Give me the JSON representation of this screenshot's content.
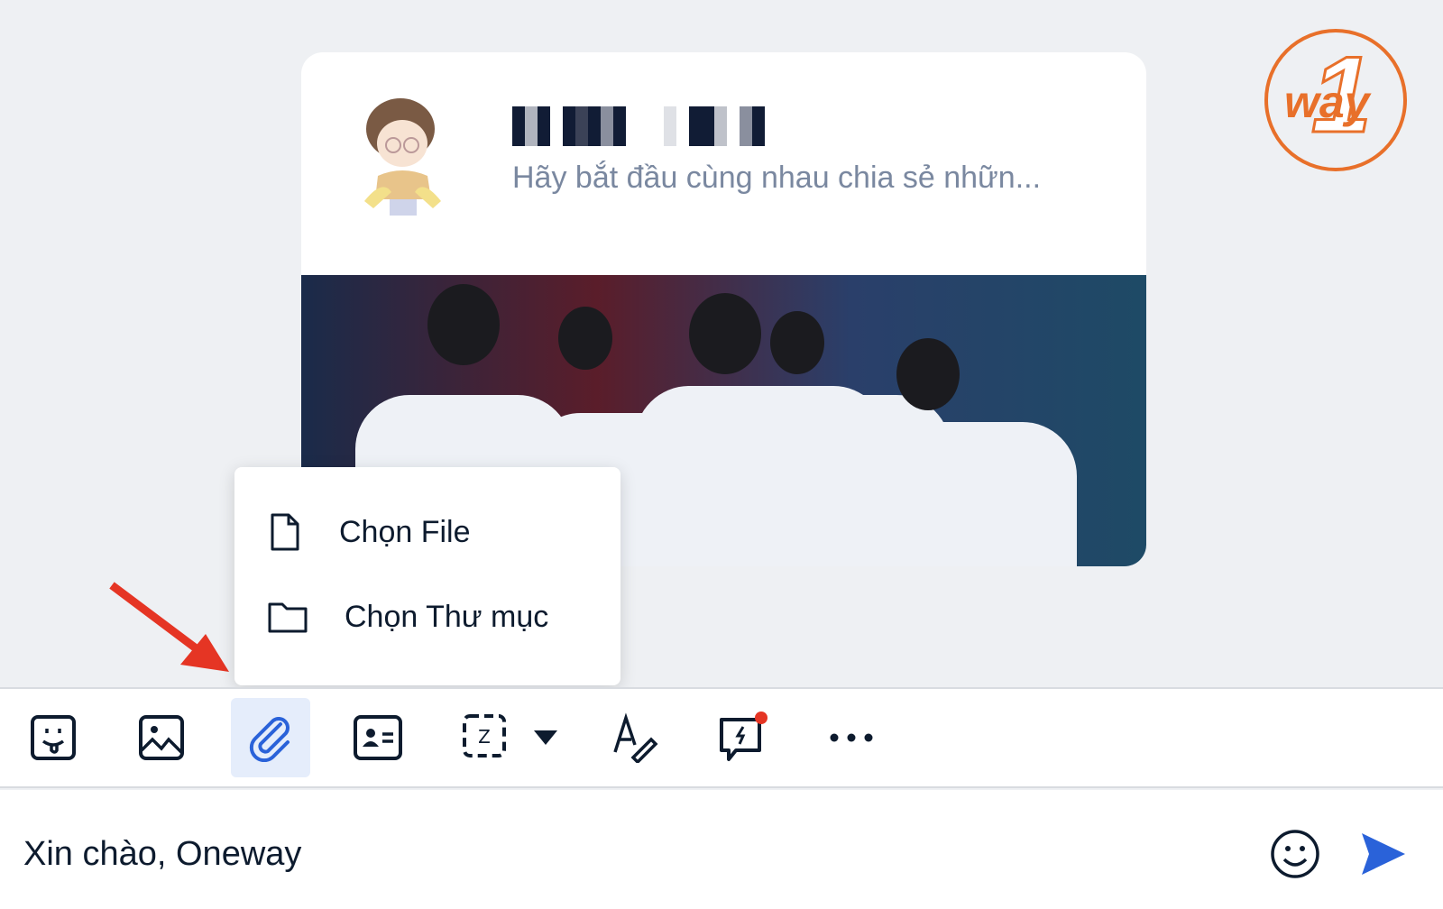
{
  "conversation": {
    "contact_name": "(pixelated)",
    "preview": "Hãy bắt đầu cùng nhau chia sẻ nhữn..."
  },
  "logo": {
    "text": "1way"
  },
  "attach_menu": {
    "items": [
      {
        "label": "Chọn File",
        "icon": "file-icon"
      },
      {
        "label": "Chọn Thư mục",
        "icon": "folder-icon"
      }
    ]
  },
  "toolbar": {
    "items": [
      "sticker-icon",
      "image-icon",
      "paperclip-icon",
      "contact-card-icon",
      "screenshot-icon",
      "text-format-icon",
      "quick-message-icon",
      "more-icon"
    ],
    "active": "paperclip-icon",
    "accent": "#2a62d9"
  },
  "composer": {
    "value": "Xin chào, Oneway"
  },
  "colors": {
    "accent": "#2a62d9",
    "logo": "#e8702a",
    "arrow": "#e53524"
  }
}
